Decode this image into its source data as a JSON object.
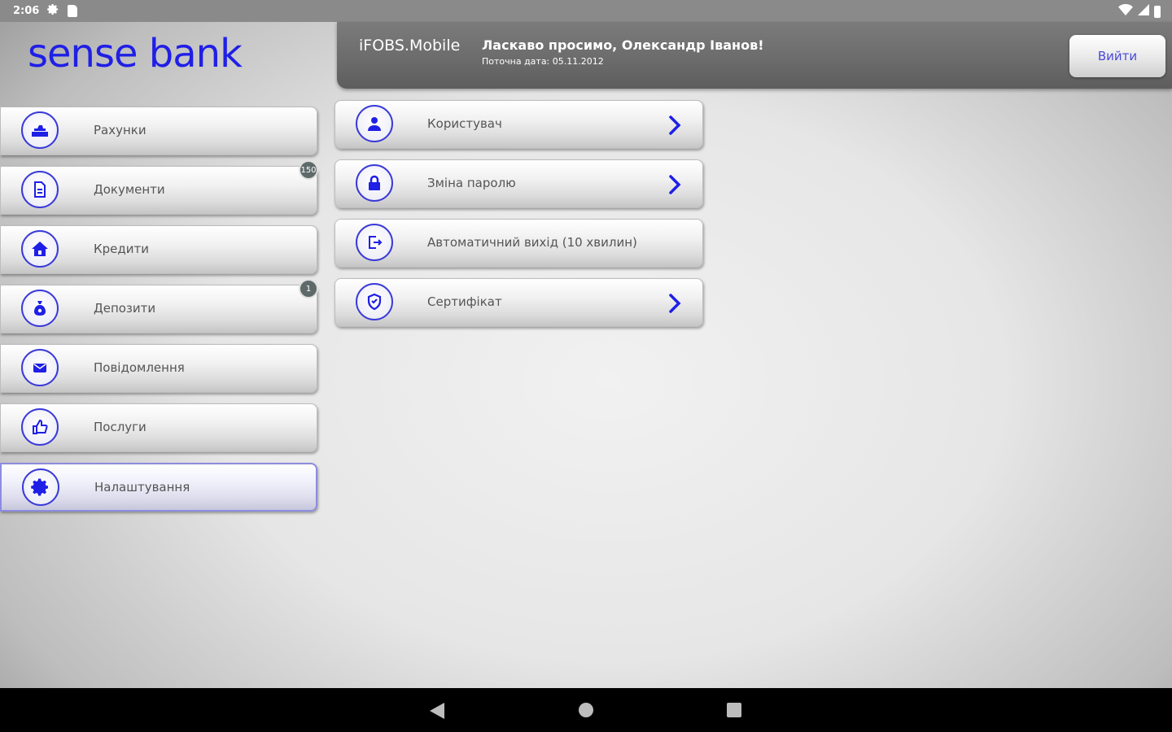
{
  "status_bar": {
    "time": "2:06"
  },
  "logo": {
    "text": "sense bank"
  },
  "header": {
    "app_name": "iFOBS.Mobile",
    "welcome": "Ласкаво просимо, Олександр Іванов!",
    "date_label": "Поточна дата: 05.11.2012",
    "logout_label": "Вийти"
  },
  "sidebar": {
    "items": [
      {
        "label": "Рахунки",
        "icon": "accounts-icon"
      },
      {
        "label": "Документи",
        "icon": "document-icon",
        "badge": "150"
      },
      {
        "label": "Кредити",
        "icon": "home-icon"
      },
      {
        "label": "Депозити",
        "icon": "money-bag-icon",
        "badge": "1"
      },
      {
        "label": "Повідомлення",
        "icon": "envelope-icon"
      },
      {
        "label": "Послуги",
        "icon": "thumbs-up-icon"
      },
      {
        "label": "Налаштування",
        "icon": "gear-icon",
        "active": true
      }
    ]
  },
  "settings": {
    "items": [
      {
        "label": "Користувач",
        "icon": "user-icon",
        "has_arrow": true
      },
      {
        "label": "Зміна паролю",
        "icon": "lock-icon",
        "has_arrow": true
      },
      {
        "label": "Автоматичний вихід (10 хвилин)",
        "icon": "exit-icon",
        "has_arrow": false
      },
      {
        "label": "Сертифікат",
        "icon": "shield-icon",
        "has_arrow": true
      }
    ]
  },
  "colors": {
    "accent": "#1f1fe6",
    "header_bg": "#6c6c6c",
    "badge_bg": "#5e6a6a"
  }
}
